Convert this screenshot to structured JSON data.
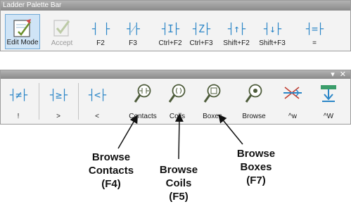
{
  "palette1": {
    "title": "Ladder Palette Bar",
    "buttons": [
      {
        "name": "edit-mode-button",
        "label": "Edit Mode",
        "icon": "edit-mode-icon"
      },
      {
        "name": "accept-button",
        "label": "Accept",
        "icon": "accept-icon"
      },
      {
        "name": "no-contact-button",
        "label": "F2",
        "glyph": "┤ ├",
        "icon": "normally-open-contact-icon"
      },
      {
        "name": "nc-contact-button",
        "label": "F3",
        "glyph": "┤⁄├",
        "icon": "normally-closed-contact-icon"
      },
      {
        "name": "pos-edge-contact-button",
        "label": "Ctrl+F2",
        "glyph": "┤I├",
        "icon": "immediate-contact-icon"
      },
      {
        "name": "neg-edge-contact-button",
        "label": "Ctrl+F3",
        "glyph": "┤Z├",
        "icon": "immediate-nc-contact-icon"
      },
      {
        "name": "rise-edge-contact-button",
        "label": "Shift+F2",
        "glyph": "┤↑├",
        "icon": "rising-edge-contact-icon"
      },
      {
        "name": "fall-edge-contact-button",
        "label": "Shift+F3",
        "glyph": "┤↓├",
        "icon": "falling-edge-contact-icon"
      },
      {
        "name": "equal-compare-button",
        "label": "=",
        "glyph": "┤=├",
        "icon": "equal-compare-icon"
      }
    ]
  },
  "palette2": {
    "window_controls": "▾ ✕",
    "buttons": [
      {
        "name": "not-equal-button",
        "label": "!",
        "glyph": "┤≠├",
        "icon": "not-equal-compare-icon"
      },
      {
        "name": "greater-equal-button",
        "label": ">",
        "glyph": "┤≥├",
        "icon": "greater-equal-compare-icon"
      },
      {
        "name": "less-than-button",
        "label": "<",
        "glyph": "┤<├",
        "icon": "less-than-compare-icon"
      },
      {
        "name": "browse-contacts-button",
        "label": "Contacts",
        "icon": "browse-contacts-icon"
      },
      {
        "name": "browse-coils-button",
        "label": "Coils",
        "icon": "browse-coils-icon"
      },
      {
        "name": "browse-boxes-button",
        "label": "Boxes",
        "icon": "browse-boxes-icon"
      },
      {
        "name": "browse-button",
        "label": "Browse",
        "icon": "browse-icon"
      },
      {
        "name": "wire-button",
        "label": "^w",
        "icon": "wire-icon"
      },
      {
        "name": "wire-delete-button",
        "label": "^W",
        "icon": "wire-delete-icon"
      }
    ]
  },
  "callouts": {
    "contacts": [
      "Browse",
      "Contacts",
      "(F4)"
    ],
    "coils": [
      "Browse",
      "Coils",
      "(F5)"
    ],
    "boxes": [
      "Browse",
      "Boxes",
      "(F7)"
    ]
  },
  "colors": {
    "accent": "#2b86c7",
    "titlebar": "#9a9a9a",
    "edit_mode_bg": "#cfe4f6"
  }
}
